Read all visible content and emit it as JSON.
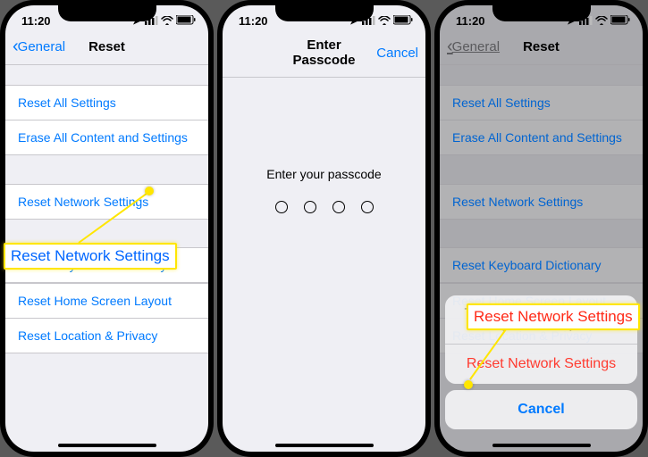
{
  "status": {
    "time": "11:20",
    "loc_icon": "location-arrow",
    "signal": 3,
    "wifi": true,
    "battery": 90
  },
  "screen1": {
    "nav": {
      "back": "General",
      "title": "Reset"
    },
    "rows": {
      "reset_all": "Reset All Settings",
      "erase_all": "Erase All Content and Settings",
      "reset_network": "Reset Network Settings",
      "reset_keyboard": "Reset Keyboard Dictionary",
      "reset_home": "Reset Home Screen Layout",
      "reset_location": "Reset Location & Privacy"
    },
    "callout": "Reset Network Settings"
  },
  "screen2": {
    "nav": {
      "title": "Enter Passcode",
      "right": "Cancel"
    },
    "prompt": "Enter your passcode"
  },
  "screen3": {
    "nav": {
      "back": "General",
      "title": "Reset"
    },
    "rows": {
      "reset_all": "Reset All Settings",
      "erase_all": "Erase All Content and Settings",
      "reset_network": "Reset Network Settings",
      "reset_keyboard": "Reset Keyboard Dictionary",
      "reset_home": "Reset Home Screen Layout",
      "reset_location": "Reset Location & Privacy"
    },
    "sheet": {
      "message": "This will delete all network settings, returning them to factory defaults.",
      "action": "Reset Network Settings",
      "cancel": "Cancel"
    },
    "callout": "Reset Network Settings"
  }
}
